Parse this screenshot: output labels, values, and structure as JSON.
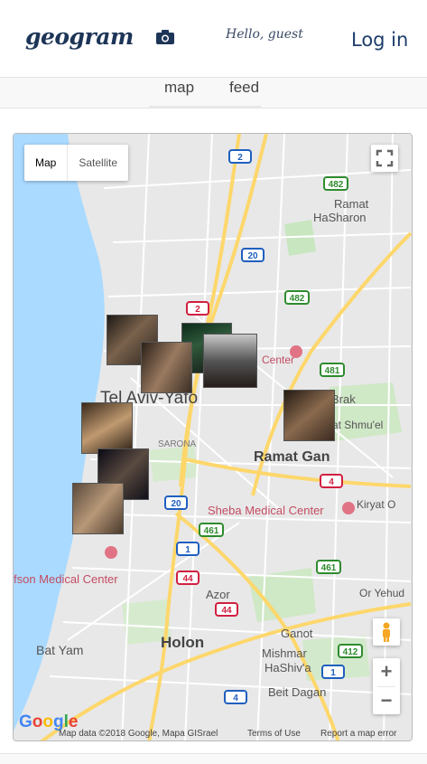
{
  "header": {
    "logo": "geogram",
    "greeting": "Hello, guest",
    "login_label": "Log in",
    "camera_icon": "camera-icon"
  },
  "tabs": [
    {
      "label": "map"
    },
    {
      "label": "feed"
    }
  ],
  "map": {
    "type_buttons": {
      "map": "Map",
      "satellite": "Satellite"
    },
    "zoom_in": "+",
    "zoom_out": "−",
    "labels": {
      "ramat_hasharon_1": "Ramat",
      "ramat_hasharon_2": "HaSharon",
      "center": "Center",
      "tel_aviv": "Tel Aviv-Yafo",
      "brak": "Brak",
      "givat": "iv'at Shmu'el",
      "sarona": "SARONA",
      "ramat_gan": "Ramat Gan",
      "sheba": "Sheba Medical Center",
      "kiryat": "Kiryat O",
      "wolfson": "fson Medical Center",
      "azor": "Azor",
      "or_yehud": "Or Yehud",
      "ganot": "Ganot",
      "bat_yam": "Bat Yam",
      "holon": "Holon",
      "mishmar_1": "Mishmar",
      "mishmar_2": "HaShiv'a",
      "beit_dagan": "Beit Dagan"
    },
    "road_shields": {
      "r2a": "2",
      "r482a": "482",
      "r20a": "20",
      "r482b": "482",
      "r2b": "2",
      "r481": "481",
      "r4a": "4",
      "r20b": "20",
      "r461a": "461",
      "r1a": "1",
      "r44a": "44",
      "r461b": "461",
      "r44b": "44",
      "r412": "412",
      "r1b": "1",
      "r4b": "4"
    },
    "attribution": {
      "data": "Map data ©2018 Google, Mapa GISrael",
      "terms": "Terms of Use",
      "report": "Report a map error"
    }
  }
}
